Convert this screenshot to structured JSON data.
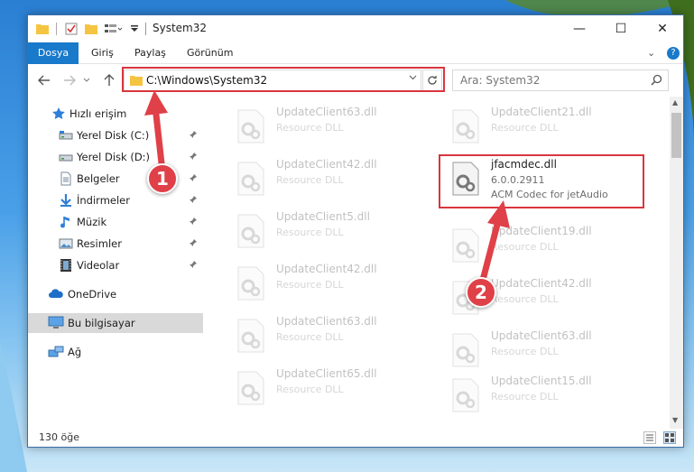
{
  "window": {
    "title": "System32",
    "minimize_glyph": "—",
    "maximize_glyph": "☐",
    "close_glyph": "✕"
  },
  "ribbon": {
    "tabs": [
      "Dosya",
      "Giriş",
      "Paylaş",
      "Görünüm"
    ],
    "help_glyph": "?",
    "expand_glyph": "⌄"
  },
  "address": {
    "path": "C:\\Windows\\System32",
    "search_placeholder": "Ara: System32"
  },
  "navigation": {
    "quick_access": "Hızlı erişim",
    "items": [
      {
        "label": "Yerel Disk (C:)",
        "icon": "drive-icon"
      },
      {
        "label": "Yerel Disk (D:)",
        "icon": "drive-icon"
      },
      {
        "label": "Belgeler",
        "icon": "documents-icon"
      },
      {
        "label": "İndirmeler",
        "icon": "downloads-icon"
      },
      {
        "label": "Müzik",
        "icon": "music-icon"
      },
      {
        "label": "Resimler",
        "icon": "pictures-icon"
      },
      {
        "label": "Videolar",
        "icon": "videos-icon"
      }
    ],
    "onedrive": "OneDrive",
    "this_pc": "Bu bilgisayar",
    "network": "Ağ"
  },
  "files": {
    "left_column": [
      {
        "name": "UpdateClient63.dll",
        "desc": "Resource DLL"
      },
      {
        "name": "UpdateClient42.dll",
        "desc": "Resource DLL"
      },
      {
        "name": "UpdateClient5.dll",
        "desc": "Resource DLL"
      },
      {
        "name": "UpdateClient42.dll",
        "desc": "Resource DLL"
      },
      {
        "name": "UpdateClient63.dll",
        "desc": "Resource DLL"
      },
      {
        "name": "UpdateClient65.dll",
        "desc": "Resource DLL"
      }
    ],
    "right_column": [
      {
        "name": "UpdateClient21.dll",
        "desc": "Resource DLL"
      },
      {
        "name": "UpdateClient19.dll",
        "desc": "Resource DLL"
      },
      {
        "name": "UpdateClient42.dll",
        "desc": "Resource DLL"
      },
      {
        "name": "UpdateClient63.dll",
        "desc": "Resource DLL"
      },
      {
        "name": "UpdateClient15.dll",
        "desc": "Resource DLL"
      }
    ],
    "highlighted": {
      "name": "jfacmdec.dll",
      "version": "6.0.0.2911",
      "description": "ACM Codec for jetAudio"
    }
  },
  "status": {
    "item_count": "130 öğe"
  },
  "annotations": {
    "step1": "1",
    "step2": "2",
    "color": "#e04048"
  }
}
